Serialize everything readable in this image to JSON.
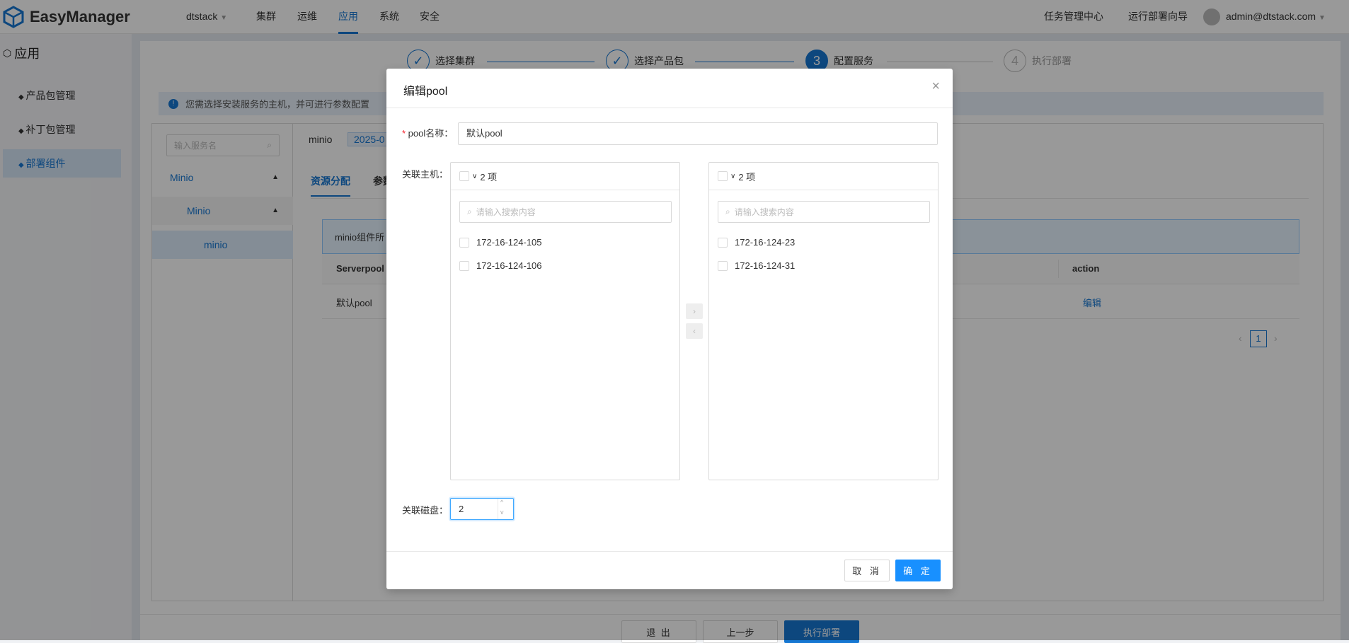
{
  "header": {
    "logo": "EasyManager",
    "cluster_select": "dtstack",
    "nav": [
      "集群",
      "运维",
      "应用",
      "系统",
      "安全"
    ],
    "active_nav": "应用",
    "task_center": "任务管理中心",
    "deploy_wizard": "运行部署向导",
    "user": "admin@dtstack.com"
  },
  "sidebar": {
    "title": "应用",
    "items": [
      {
        "label": "产品包管理"
      },
      {
        "label": "补丁包管理"
      },
      {
        "label": "部署组件"
      }
    ]
  },
  "steps": [
    {
      "num": "1",
      "label": "选择集群"
    },
    {
      "num": "2",
      "label": "选择产品包"
    },
    {
      "num": "3",
      "label": "配置服务"
    },
    {
      "num": "4",
      "label": "执行部署"
    }
  ],
  "alert": "您需选择安装服务的主机，并可进行参数配置",
  "tree": {
    "search_placeholder": "输入服务名",
    "items": [
      "Minio",
      "Minio",
      "minio"
    ]
  },
  "service": {
    "name": "minio",
    "version": "2025-0"
  },
  "tabs": [
    "资源分配",
    "参数"
  ],
  "table": {
    "info": "minio组件所",
    "headers": [
      "Serverpool",
      "action"
    ],
    "rows": [
      {
        "pool": "默认pool",
        "action": "编辑"
      }
    ],
    "page": "1"
  },
  "footer": {
    "exit": "退 出",
    "prev": "上一步",
    "deploy": "执行部署"
  },
  "modal": {
    "title": "编辑pool",
    "pool_name_label": "pool名称",
    "pool_name_value": "默认pool",
    "hosts_label": "关联主机",
    "left": {
      "count": "2 项",
      "search_placeholder": "请输入搜索内容",
      "items": [
        "172-16-124-105",
        "172-16-124-106"
      ]
    },
    "right": {
      "count": "2 项",
      "search_placeholder": "请输入搜索内容",
      "items": [
        "172-16-124-23",
        "172-16-124-31"
      ]
    },
    "disk_label": "关联磁盘",
    "disk_value": "2",
    "cancel": "取 消",
    "ok": "确 定"
  },
  "colors": {
    "primary": "#1677d2",
    "button": "#1890ff"
  }
}
